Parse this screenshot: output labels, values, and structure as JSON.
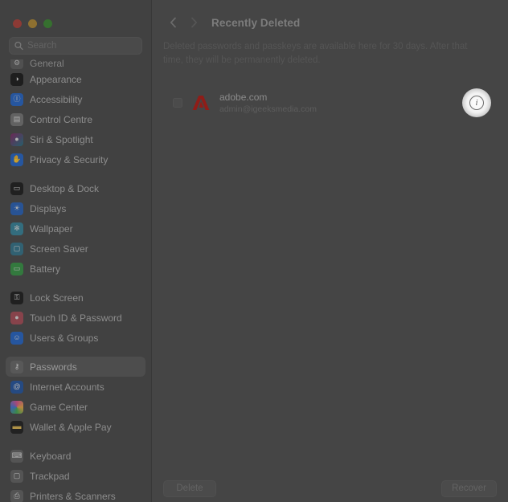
{
  "window": {
    "traffic_lights": [
      "close",
      "minimize",
      "zoom"
    ]
  },
  "sidebar": {
    "search": {
      "placeholder": "Search",
      "value": "",
      "icon": "search-icon"
    },
    "groups": [
      {
        "items": [
          {
            "label": "General",
            "icon": "gear-icon",
            "clipped": true,
            "selected": false
          },
          {
            "label": "Appearance",
            "icon": "appearance-icon",
            "clipped": false,
            "selected": false
          },
          {
            "label": "Accessibility",
            "icon": "accessibility-icon",
            "clipped": false,
            "selected": false
          },
          {
            "label": "Control Centre",
            "icon": "control-centre-icon",
            "clipped": false,
            "selected": false
          },
          {
            "label": "Siri & Spotlight",
            "icon": "siri-icon",
            "clipped": false,
            "selected": false
          },
          {
            "label": "Privacy & Security",
            "icon": "privacy-icon",
            "clipped": false,
            "selected": false
          }
        ]
      },
      {
        "items": [
          {
            "label": "Desktop & Dock",
            "icon": "desktop-dock-icon",
            "clipped": false,
            "selected": false
          },
          {
            "label": "Displays",
            "icon": "displays-icon",
            "clipped": false,
            "selected": false
          },
          {
            "label": "Wallpaper",
            "icon": "wallpaper-icon",
            "clipped": false,
            "selected": false
          },
          {
            "label": "Screen Saver",
            "icon": "screen-saver-icon",
            "clipped": false,
            "selected": false
          },
          {
            "label": "Battery",
            "icon": "battery-icon",
            "clipped": false,
            "selected": false
          }
        ]
      },
      {
        "items": [
          {
            "label": "Lock Screen",
            "icon": "lock-screen-icon",
            "clipped": false,
            "selected": false
          },
          {
            "label": "Touch ID & Password",
            "icon": "touch-id-icon",
            "clipped": false,
            "selected": false
          },
          {
            "label": "Users & Groups",
            "icon": "users-groups-icon",
            "clipped": false,
            "selected": false
          }
        ]
      },
      {
        "items": [
          {
            "label": "Passwords",
            "icon": "passwords-key-icon",
            "clipped": false,
            "selected": true
          },
          {
            "label": "Internet Accounts",
            "icon": "internet-accounts-icon",
            "clipped": false,
            "selected": false
          },
          {
            "label": "Game Center",
            "icon": "game-center-icon",
            "clipped": false,
            "selected": false
          },
          {
            "label": "Wallet & Apple Pay",
            "icon": "wallet-icon",
            "clipped": false,
            "selected": false
          }
        ]
      },
      {
        "items": [
          {
            "label": "Keyboard",
            "icon": "keyboard-icon",
            "clipped": false,
            "selected": false
          },
          {
            "label": "Trackpad",
            "icon": "trackpad-icon",
            "clipped": false,
            "selected": false
          },
          {
            "label": "Printers & Scanners",
            "icon": "printer-icon",
            "clipped": true,
            "selected": false
          }
        ]
      }
    ]
  },
  "main": {
    "nav": {
      "back_icon": "chevron-left-icon",
      "forward_icon": "chevron-right-icon"
    },
    "title": "Recently Deleted",
    "description": "Deleted passwords and passkeys are available here for 30 days. After that time, they will be permanently deleted.",
    "items": [
      {
        "site": "adobe.com",
        "account": "admin@igeeksmedia.com",
        "favicon": "adobe-logo-icon",
        "checked": false,
        "info_icon": "info-circle-icon"
      }
    ],
    "footer": {
      "delete_label": "Delete",
      "recover_label": "Recover"
    }
  },
  "colors": {
    "window_bg": "#454545",
    "sidebar_bg": "#414141",
    "selected_row": "#4d4d4d",
    "adobe_red": "#8f1d18",
    "highlight_white": "#ffffff"
  }
}
